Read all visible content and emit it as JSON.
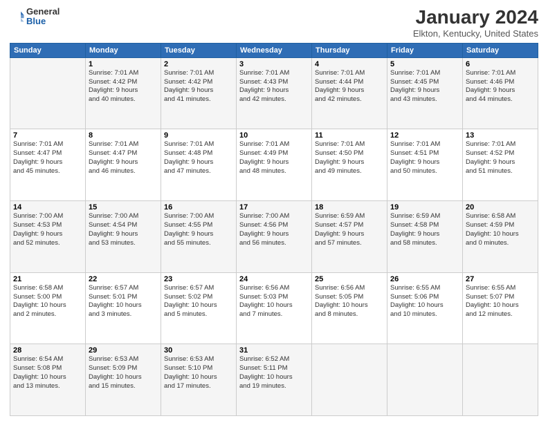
{
  "header": {
    "logo_line1": "General",
    "logo_line2": "Blue",
    "title": "January 2024",
    "subtitle": "Elkton, Kentucky, United States"
  },
  "columns": [
    "Sunday",
    "Monday",
    "Tuesday",
    "Wednesday",
    "Thursday",
    "Friday",
    "Saturday"
  ],
  "weeks": [
    [
      {
        "day": "",
        "sunrise": "",
        "sunset": "",
        "daylight": ""
      },
      {
        "day": "1",
        "sunrise": "7:01 AM",
        "sunset": "4:42 PM",
        "daylight": "9 hours and 40 minutes."
      },
      {
        "day": "2",
        "sunrise": "7:01 AM",
        "sunset": "4:42 PM",
        "daylight": "9 hours and 41 minutes."
      },
      {
        "day": "3",
        "sunrise": "7:01 AM",
        "sunset": "4:43 PM",
        "daylight": "9 hours and 42 minutes."
      },
      {
        "day": "4",
        "sunrise": "7:01 AM",
        "sunset": "4:44 PM",
        "daylight": "9 hours and 42 minutes."
      },
      {
        "day": "5",
        "sunrise": "7:01 AM",
        "sunset": "4:45 PM",
        "daylight": "9 hours and 43 minutes."
      },
      {
        "day": "6",
        "sunrise": "7:01 AM",
        "sunset": "4:46 PM",
        "daylight": "9 hours and 44 minutes."
      }
    ],
    [
      {
        "day": "7",
        "sunrise": "7:01 AM",
        "sunset": "4:47 PM",
        "daylight": "9 hours and 45 minutes."
      },
      {
        "day": "8",
        "sunrise": "7:01 AM",
        "sunset": "4:47 PM",
        "daylight": "9 hours and 46 minutes."
      },
      {
        "day": "9",
        "sunrise": "7:01 AM",
        "sunset": "4:48 PM",
        "daylight": "9 hours and 47 minutes."
      },
      {
        "day": "10",
        "sunrise": "7:01 AM",
        "sunset": "4:49 PM",
        "daylight": "9 hours and 48 minutes."
      },
      {
        "day": "11",
        "sunrise": "7:01 AM",
        "sunset": "4:50 PM",
        "daylight": "9 hours and 49 minutes."
      },
      {
        "day": "12",
        "sunrise": "7:01 AM",
        "sunset": "4:51 PM",
        "daylight": "9 hours and 50 minutes."
      },
      {
        "day": "13",
        "sunrise": "7:01 AM",
        "sunset": "4:52 PM",
        "daylight": "9 hours and 51 minutes."
      }
    ],
    [
      {
        "day": "14",
        "sunrise": "7:00 AM",
        "sunset": "4:53 PM",
        "daylight": "9 hours and 52 minutes."
      },
      {
        "day": "15",
        "sunrise": "7:00 AM",
        "sunset": "4:54 PM",
        "daylight": "9 hours and 53 minutes."
      },
      {
        "day": "16",
        "sunrise": "7:00 AM",
        "sunset": "4:55 PM",
        "daylight": "9 hours and 55 minutes."
      },
      {
        "day": "17",
        "sunrise": "7:00 AM",
        "sunset": "4:56 PM",
        "daylight": "9 hours and 56 minutes."
      },
      {
        "day": "18",
        "sunrise": "6:59 AM",
        "sunset": "4:57 PM",
        "daylight": "9 hours and 57 minutes."
      },
      {
        "day": "19",
        "sunrise": "6:59 AM",
        "sunset": "4:58 PM",
        "daylight": "9 hours and 58 minutes."
      },
      {
        "day": "20",
        "sunrise": "6:58 AM",
        "sunset": "4:59 PM",
        "daylight": "10 hours and 0 minutes."
      }
    ],
    [
      {
        "day": "21",
        "sunrise": "6:58 AM",
        "sunset": "5:00 PM",
        "daylight": "10 hours and 2 minutes."
      },
      {
        "day": "22",
        "sunrise": "6:57 AM",
        "sunset": "5:01 PM",
        "daylight": "10 hours and 3 minutes."
      },
      {
        "day": "23",
        "sunrise": "6:57 AM",
        "sunset": "5:02 PM",
        "daylight": "10 hours and 5 minutes."
      },
      {
        "day": "24",
        "sunrise": "6:56 AM",
        "sunset": "5:03 PM",
        "daylight": "10 hours and 7 minutes."
      },
      {
        "day": "25",
        "sunrise": "6:56 AM",
        "sunset": "5:05 PM",
        "daylight": "10 hours and 8 minutes."
      },
      {
        "day": "26",
        "sunrise": "6:55 AM",
        "sunset": "5:06 PM",
        "daylight": "10 hours and 10 minutes."
      },
      {
        "day": "27",
        "sunrise": "6:55 AM",
        "sunset": "5:07 PM",
        "daylight": "10 hours and 12 minutes."
      }
    ],
    [
      {
        "day": "28",
        "sunrise": "6:54 AM",
        "sunset": "5:08 PM",
        "daylight": "10 hours and 13 minutes."
      },
      {
        "day": "29",
        "sunrise": "6:53 AM",
        "sunset": "5:09 PM",
        "daylight": "10 hours and 15 minutes."
      },
      {
        "day": "30",
        "sunrise": "6:53 AM",
        "sunset": "5:10 PM",
        "daylight": "10 hours and 17 minutes."
      },
      {
        "day": "31",
        "sunrise": "6:52 AM",
        "sunset": "5:11 PM",
        "daylight": "10 hours and 19 minutes."
      },
      {
        "day": "",
        "sunrise": "",
        "sunset": "",
        "daylight": ""
      },
      {
        "day": "",
        "sunrise": "",
        "sunset": "",
        "daylight": ""
      },
      {
        "day": "",
        "sunrise": "",
        "sunset": "",
        "daylight": ""
      }
    ]
  ]
}
